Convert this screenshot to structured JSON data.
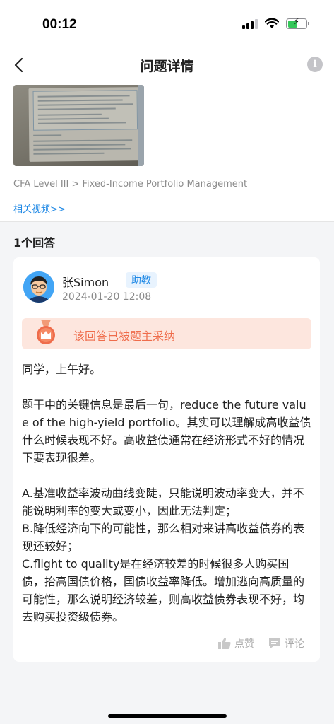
{
  "status_bar": {
    "time": "00:12"
  },
  "nav": {
    "title": "问题详情"
  },
  "question": {
    "breadcrumb": "CFA Level III > Fixed-Income Portfolio Management",
    "related_video_link": "相关视频>>"
  },
  "answers_count": "1个回答",
  "answer": {
    "author": "张Simon",
    "role": "助教",
    "time": "2024-01-20 12:08",
    "accepted_text": "该回答已被题主采纳",
    "paragraphs": [
      "同学，上午好。",
      "",
      "题干中的关键信息是最后一句，reduce the future value of the high-yield portfolio。其实可以理解成高收益债什么时候表现不好。高收益债通常在经济形式不好的情况下要表现很差。",
      "",
      "A.基准收益率波动曲线变陡，只能说明波动率变大，并不能说明利率的变大或变小，因此无法判定；",
      "B.降低经济向下的可能性，那么相对来讲高收益债券的表现还较好；",
      "C.flight to quality是在经济较差的时候很多人购买国债，抬高国债价格，国债收益率降低。增加逃向高质量的可能性，那么说明经济较差，则高收益债券表现不好，均去购买投资级债券。"
    ],
    "like_label": "点赞",
    "comment_label": "评论"
  },
  "colors": {
    "link": "#1e88e5",
    "accepted": "#ef6c4b",
    "accepted_bg": "#fde6de"
  }
}
